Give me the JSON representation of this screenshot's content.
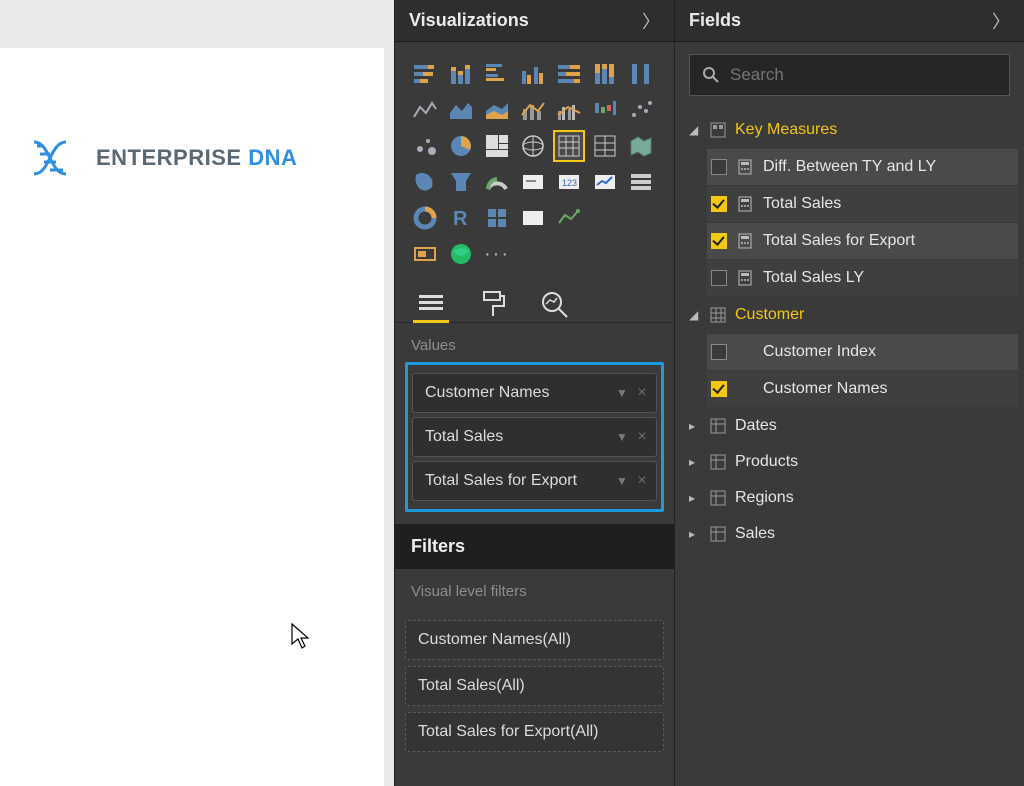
{
  "logo": {
    "part1": "ENTERPRISE ",
    "part2": "DNA"
  },
  "viz_panel": {
    "title": "Visualizations",
    "values_label": "Values",
    "values": [
      {
        "name": "Customer Names"
      },
      {
        "name": "Total Sales"
      },
      {
        "name": "Total Sales for Export"
      }
    ],
    "filters_title": "Filters",
    "visual_filters_label": "Visual level filters",
    "visual_filters": [
      {
        "label": "Customer Names(All)"
      },
      {
        "label": "Total Sales(All)"
      },
      {
        "label": "Total Sales for Export(All)"
      }
    ]
  },
  "fields_panel": {
    "title": "Fields",
    "search_placeholder": "Search",
    "tables": [
      {
        "name": "Key Measures",
        "expanded": true,
        "icon": "measure-table",
        "fields": [
          {
            "name": "Diff. Between TY and LY",
            "checked": false,
            "type": "measure"
          },
          {
            "name": "Total Sales",
            "checked": true,
            "type": "measure"
          },
          {
            "name": "Total Sales for Export",
            "checked": true,
            "type": "measure"
          },
          {
            "name": "Total Sales LY",
            "checked": false,
            "type": "measure"
          }
        ]
      },
      {
        "name": "Customer",
        "expanded": true,
        "icon": "table",
        "fields": [
          {
            "name": "Customer Index",
            "checked": false,
            "type": "column"
          },
          {
            "name": "Customer Names",
            "checked": true,
            "type": "column"
          }
        ]
      },
      {
        "name": "Dates",
        "expanded": false,
        "icon": "table"
      },
      {
        "name": "Products",
        "expanded": false,
        "icon": "table"
      },
      {
        "name": "Regions",
        "expanded": false,
        "icon": "table"
      },
      {
        "name": "Sales",
        "expanded": false,
        "icon": "table"
      }
    ]
  }
}
